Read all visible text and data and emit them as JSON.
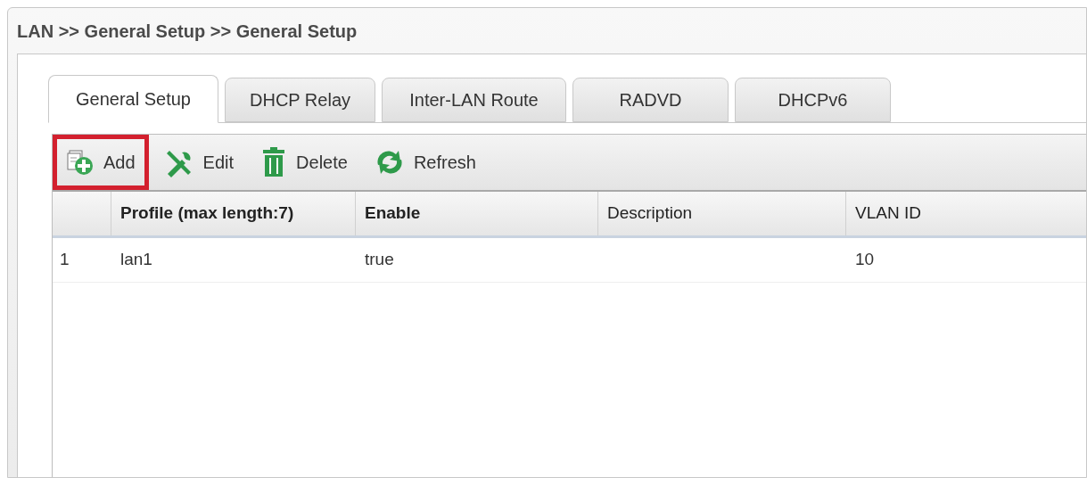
{
  "breadcrumb": "LAN >> General Setup >> General Setup",
  "tabs": [
    {
      "label": "General Setup",
      "selected": true
    },
    {
      "label": "DHCP Relay",
      "selected": false
    },
    {
      "label": "Inter-LAN Route",
      "selected": false
    },
    {
      "label": "RADVD",
      "selected": false
    },
    {
      "label": "DHCPv6",
      "selected": false
    }
  ],
  "toolbar": [
    {
      "kind": "add",
      "label": "Add",
      "highlighted": true
    },
    {
      "kind": "edit",
      "label": "Edit",
      "highlighted": false
    },
    {
      "kind": "delete",
      "label": "Delete",
      "highlighted": false
    },
    {
      "kind": "refresh",
      "label": "Refresh",
      "highlighted": false
    }
  ],
  "table": {
    "columns": [
      "Profile (max length:7)",
      "Enable",
      "Description",
      "VLAN ID"
    ],
    "rows": [
      {
        "index": "1",
        "cells": [
          "lan1",
          "true",
          "",
          "10"
        ]
      }
    ]
  }
}
